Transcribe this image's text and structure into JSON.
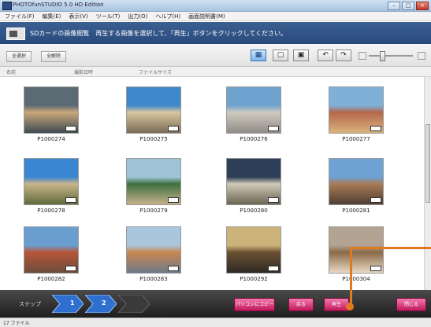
{
  "window": {
    "title": "PHOTOfunSTUDIO 5.0 HD Edition",
    "controls": [
      "–",
      "□",
      "×"
    ]
  },
  "menu": [
    "ファイル(F)",
    "編集(E)",
    "表示(V)",
    "ツール(T)",
    "出力(O)",
    "ヘルプ(H)",
    "画面説明書(M)"
  ],
  "instruction": "SDカードの画像閲覧　再生する画像を選択して、「再生」ボタンをクリックしてください。",
  "toolbar": {
    "select_all": "全選択",
    "deselect_all": "全解除",
    "view_icons": [
      "grid-view-icon",
      "single-view-icon",
      "info-view-icon",
      "rotate-left-icon",
      "rotate-right-icon"
    ]
  },
  "columns": [
    "名前",
    "撮影日時",
    "ファイルサイズ"
  ],
  "thumbnails": [
    {
      "name": "P1000274",
      "colors": [
        "#5b6a73",
        "#c9a77a",
        "#3e4b52"
      ]
    },
    {
      "name": "P1000275",
      "colors": [
        "#3f88c9",
        "#d8c6a0",
        "#7a6b55"
      ]
    },
    {
      "name": "P1000276",
      "colors": [
        "#6fa3cf",
        "#cfcac0",
        "#8f8c86"
      ]
    },
    {
      "name": "P1000277",
      "colors": [
        "#7fb0d8",
        "#b4674a",
        "#d9b37d"
      ]
    },
    {
      "name": "P1000278",
      "colors": [
        "#3a86d1",
        "#c9b58a",
        "#5f6b3b"
      ]
    },
    {
      "name": "P1000279",
      "colors": [
        "#9fc3d6",
        "#3d6f3e",
        "#c6b08a"
      ]
    },
    {
      "name": "P1000280",
      "colors": [
        "#2d3f57",
        "#d0c9b8",
        "#6b6452"
      ]
    },
    {
      "name": "P1000281",
      "colors": [
        "#6ea1d4",
        "#a87b55",
        "#4f3f35"
      ]
    },
    {
      "name": "P1000282",
      "colors": [
        "#6a9ecf",
        "#b8553a",
        "#6b4d3a"
      ]
    },
    {
      "name": "P1000283",
      "colors": [
        "#aac6dd",
        "#c88650",
        "#6d7a8a"
      ]
    },
    {
      "name": "P1000292",
      "colors": [
        "#cdb27a",
        "#6b5133",
        "#2e2a24"
      ]
    },
    {
      "name": "P1000304",
      "colors": [
        "#b3a392",
        "#8a6a48",
        "#e8d9c4"
      ]
    }
  ],
  "steps": {
    "label": "ステップ",
    "items": [
      "1",
      "2"
    ]
  },
  "buttons": {
    "copy_to_pc": "パソコンにコピー",
    "back": "戻る",
    "play": "再生",
    "close": "閉じる"
  },
  "status": "17 ファイル",
  "accent_color": "#e07a1f"
}
